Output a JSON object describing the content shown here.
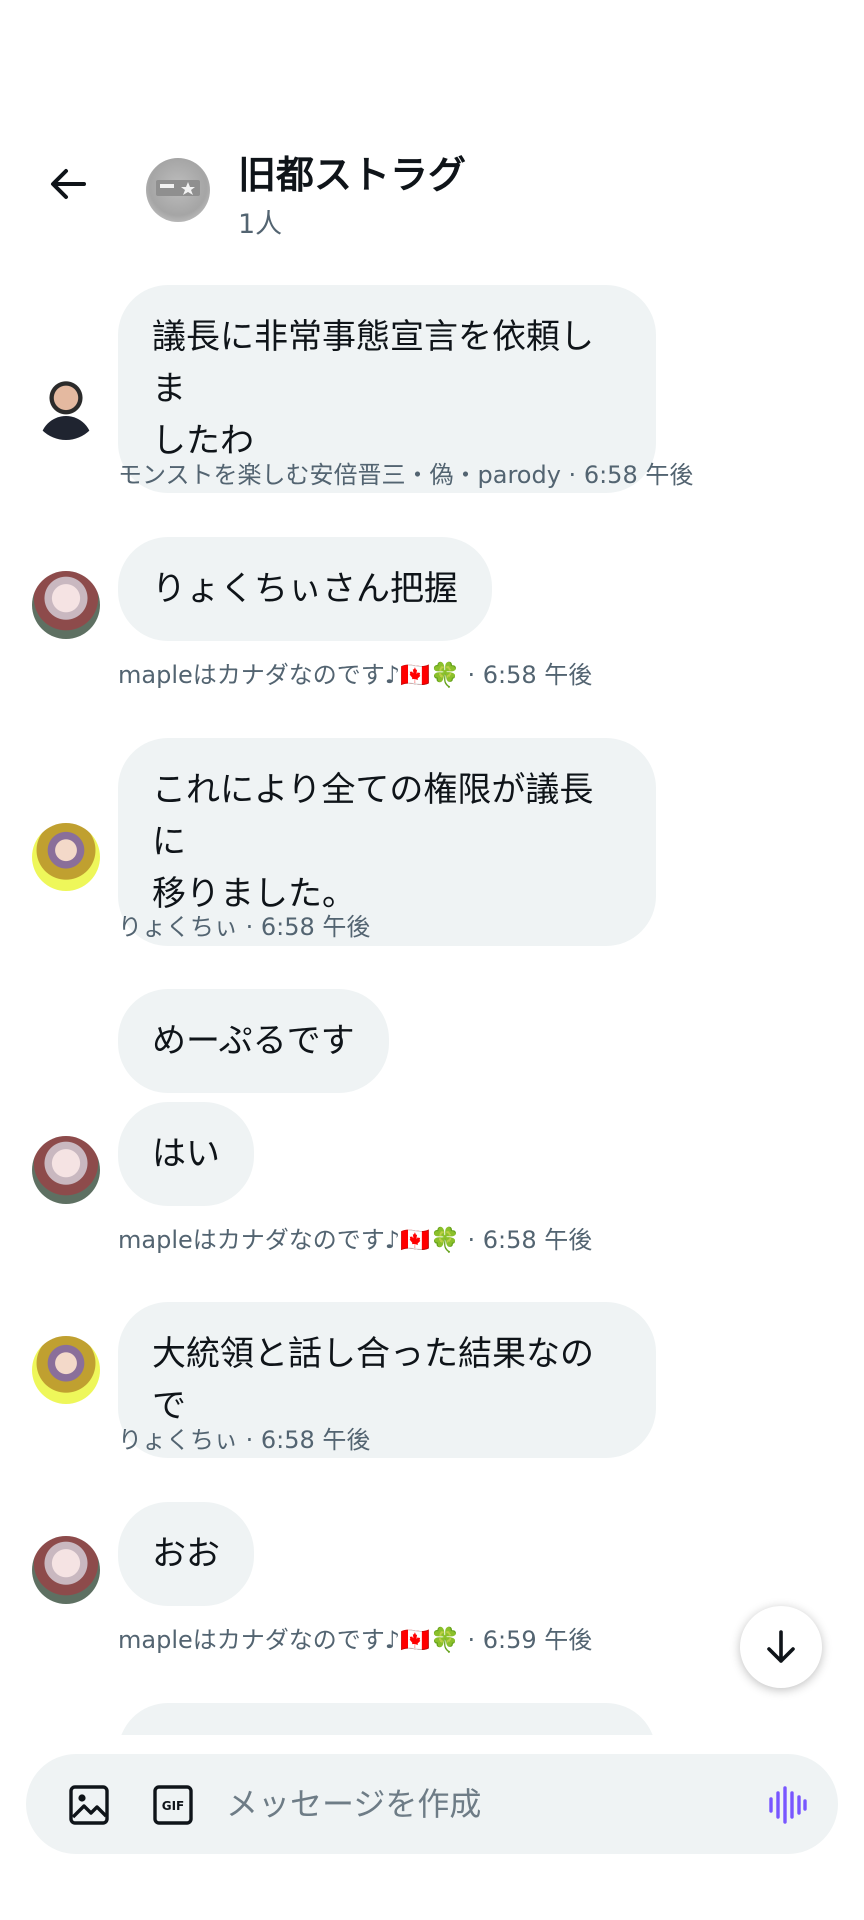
{
  "header": {
    "title": "旧都ストラグ",
    "member_count": "1人"
  },
  "messages": [
    {
      "text": "議長に非常事態宣言を依頼しま\nしたわ",
      "sender": "モンストを楽しむ安倍晋三・偽・parody",
      "time": "6:58 午後"
    },
    {
      "text": "りょくちぃさん把握",
      "sender": "mapleはカナダなのです♪🇨🇦🍀",
      "time": "6:58 午後"
    },
    {
      "text": "これにより全ての権限が議長に\n移りました。",
      "sender": "りょくちぃ",
      "time": "6:58 午後"
    },
    {
      "text": "めーぷるです"
    },
    {
      "text": "はい",
      "sender": "mapleはカナダなのです♪🇨🇦🍀",
      "time": "6:58 午後"
    },
    {
      "text": "大統領と話し合った結果なので",
      "sender": "りょくちぃ",
      "time": "6:58 午後"
    },
    {
      "text": "おお",
      "sender": "mapleはカナダなのです♪🇨🇦🍀",
      "time": "6:59 午後"
    }
  ],
  "meta_separator": " · ",
  "composer": {
    "placeholder": "メッセージを作成",
    "icons": [
      "image-icon",
      "gif-icon",
      "voice-icon"
    ]
  },
  "colors": {
    "bubble": "#eff3f4",
    "meta_text": "#536471",
    "voice_accent": "#7856ff"
  }
}
